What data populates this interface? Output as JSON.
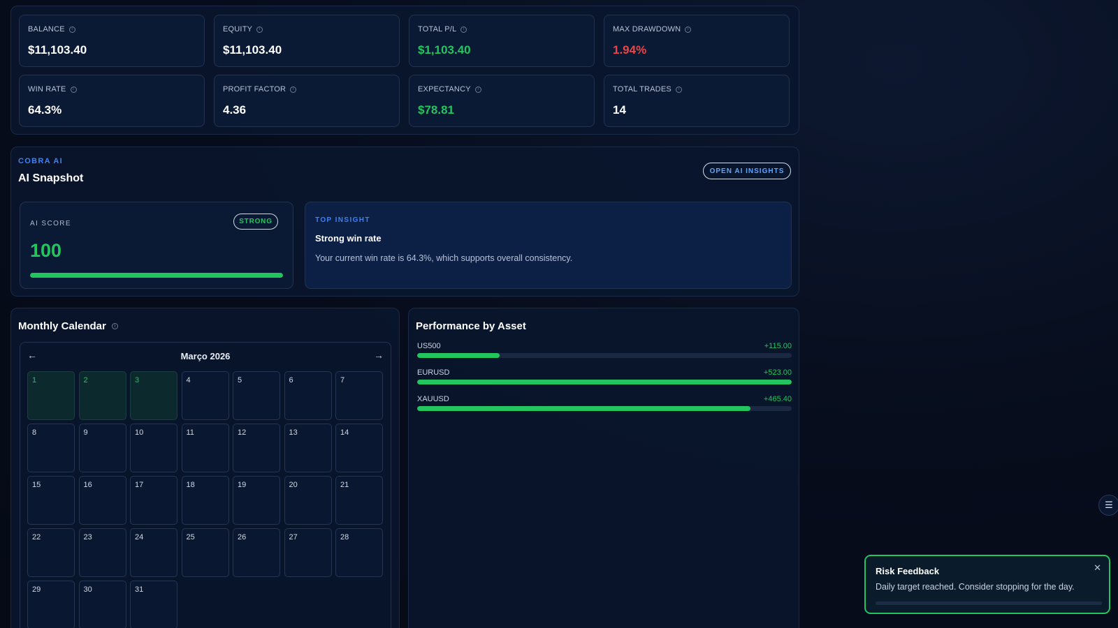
{
  "stats": [
    {
      "label": "BALANCE",
      "value": "$11,103.40",
      "tone": "white"
    },
    {
      "label": "EQUITY",
      "value": "$11,103.40",
      "tone": "white"
    },
    {
      "label": "TOTAL P/L",
      "value": "$1,103.40",
      "tone": "green"
    },
    {
      "label": "MAX DRAWDOWN",
      "value": "1.94%",
      "tone": "red"
    },
    {
      "label": "WIN RATE",
      "value": "64.3%",
      "tone": "white"
    },
    {
      "label": "PROFIT FACTOR",
      "value": "4.36",
      "tone": "white"
    },
    {
      "label": "EXPECTANCY",
      "value": "$78.81",
      "tone": "green"
    },
    {
      "label": "TOTAL TRADES",
      "value": "14",
      "tone": "white"
    }
  ],
  "ai_snapshot": {
    "kicker": "COBRA AI",
    "title": "AI Snapshot",
    "open_button": "OPEN AI INSIGHTS",
    "score_label": "AI SCORE",
    "score_badge": "STRONG",
    "score_value": "100",
    "score_progress": 1.0,
    "insight_kicker": "TOP INSIGHT",
    "insight_title": "Strong win rate",
    "insight_text": "Your current win rate is 64.3%, which supports overall consistency."
  },
  "calendar": {
    "title": "Monthly Calendar",
    "prev_icon": "arrow-left-icon",
    "next_icon": "arrow-right-icon",
    "month_label": "Março 2026",
    "days": [
      "1",
      "2",
      "3",
      "4",
      "5",
      "6",
      "7",
      "8",
      "9",
      "10",
      "11",
      "12",
      "13",
      "14",
      "15",
      "16",
      "17",
      "18",
      "19",
      "20",
      "21",
      "22",
      "23",
      "24",
      "25",
      "26",
      "27",
      "28",
      "29",
      "30",
      "31"
    ],
    "positive_days": [
      "1",
      "2",
      "3"
    ]
  },
  "performance": {
    "title": "Performance by Asset",
    "assets": [
      {
        "name": "US500",
        "value": "+115.00",
        "fill": 0.22
      },
      {
        "name": "EURUSD",
        "value": "+523.00",
        "fill": 1.0
      },
      {
        "name": "XAUUSD",
        "value": "+465.40",
        "fill": 0.89
      }
    ]
  },
  "toast": {
    "title": "Risk Feedback",
    "message": "Daily target reached. Consider stopping for the day.",
    "close_icon": "close-icon",
    "progress": 0.0
  },
  "colors": {
    "accent_green": "#22c55e",
    "accent_red": "#ef4444",
    "accent_blue": "#3b82f6",
    "background": "#070d1c"
  }
}
